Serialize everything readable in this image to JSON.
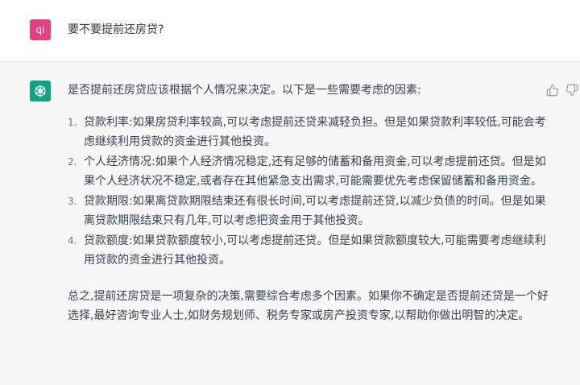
{
  "user": {
    "avatar_label": "qi",
    "avatar_color": "#e83f7f",
    "message": "要不要提前还房贷?"
  },
  "assistant": {
    "avatar_color": "#10a37f",
    "intro": "是否提前还房贷应该根据个人情况来决定。以下是一些需要考虑的因素:",
    "items": [
      {
        "num": "1.",
        "text": "贷款利率:如果房贷利率较高,可以考虑提前还贷来减轻负担。但是如果贷款利率较低,可能会考虑继续利用贷款的资金进行其他投资。"
      },
      {
        "num": "2.",
        "text": "个人经济情况:如果个人经济情况稳定,还有足够的储蓄和备用资金,可以考虑提前还贷。但是如果个人经济状况不稳定,或者存在其他紧急支出需求,可能需要优先考虑保留储蓄和备用资金。"
      },
      {
        "num": "3.",
        "text": "贷款期限:如果离贷款期限结束还有很长时间,可以考虑提前还贷,以减少负债的时间。但是如果离贷款期限结束只有几年,可以考虑把资金用于其他投资。"
      },
      {
        "num": "4.",
        "text": "贷款额度:如果贷款额度较小,可以考虑提前还贷。但是如果贷款额度较大,可能需要考虑继续利用贷款的资金进行其他投资。"
      }
    ],
    "summary": "总之,提前还房贷是一项复杂的决策,需要综合考虑多个因素。如果你不确定是否提前还贷是一个好选择,最好咨询专业人士,如财务规划师、税务专家或房产投资专家,以帮助你做出明智的决定。"
  },
  "feedback": {
    "thumbs_up_icon": "thumbs-up-icon",
    "thumbs_down_icon": "thumbs-down-icon"
  }
}
